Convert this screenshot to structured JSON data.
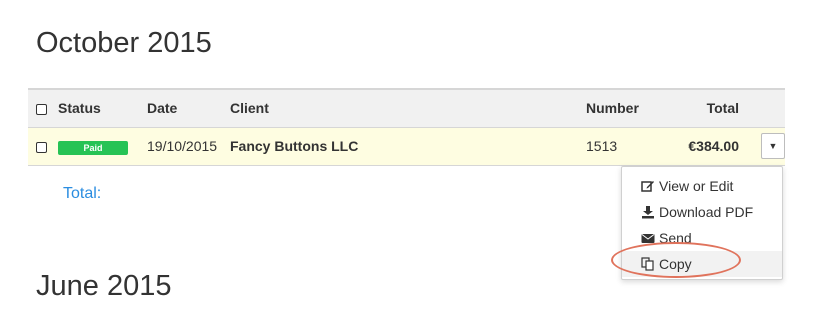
{
  "sections": [
    {
      "heading": "October 2015",
      "table": {
        "columns": {
          "status": "Status",
          "date": "Date",
          "client": "Client",
          "number": "Number",
          "total": "Total"
        },
        "rows": [
          {
            "status": "Paid",
            "date": "19/10/2015",
            "client": "Fancy Buttons LLC",
            "number": "1513",
            "total": "€384.00"
          }
        ]
      },
      "total_label": "Total:"
    },
    {
      "heading": "June 2015"
    }
  ],
  "row_menu": {
    "items": [
      {
        "label": "View or Edit",
        "icon": "edit-icon"
      },
      {
        "label": "Download PDF",
        "icon": "download-icon"
      },
      {
        "label": "Send",
        "icon": "envelope-icon"
      },
      {
        "label": "Copy",
        "icon": "copy-icon",
        "highlighted": true
      }
    ]
  },
  "colors": {
    "paid_badge": "#26c355",
    "row_background": "#fefde1",
    "header_background": "#f1f1f1",
    "total_label": "#2b8de0",
    "annotation": "#e0735c"
  }
}
